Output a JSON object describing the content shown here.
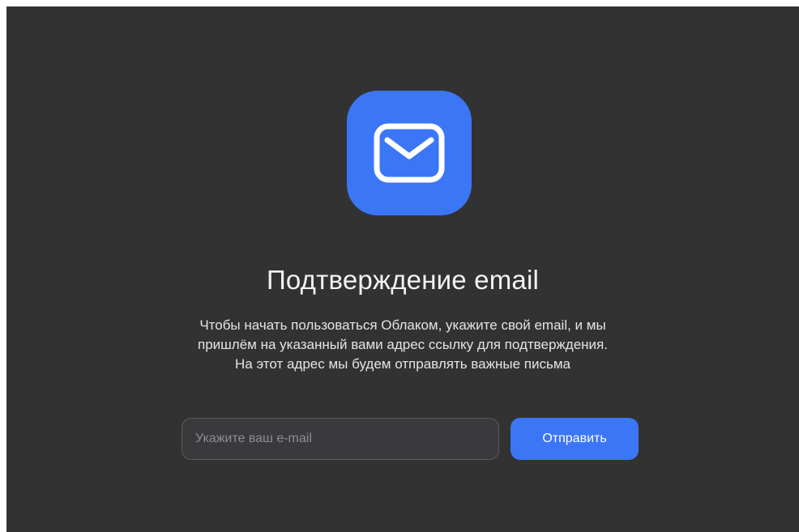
{
  "hero": {
    "icon": "envelope-icon",
    "tile_color": "#3b76f6"
  },
  "title": "Подтверждение email",
  "description": {
    "line1": "Чтобы начать пользоваться Облаком, укажите свой email, и мы",
    "line2": "пришлём на указанный вами адрес ссылку для подтверждения.",
    "line3": "На этот адрес мы будем отправлять важные письма"
  },
  "form": {
    "email_placeholder": "Укажите ваш e-mail",
    "email_value": "",
    "submit_label": "Отправить"
  },
  "colors": {
    "background": "#323232",
    "accent": "#3b76f6"
  }
}
